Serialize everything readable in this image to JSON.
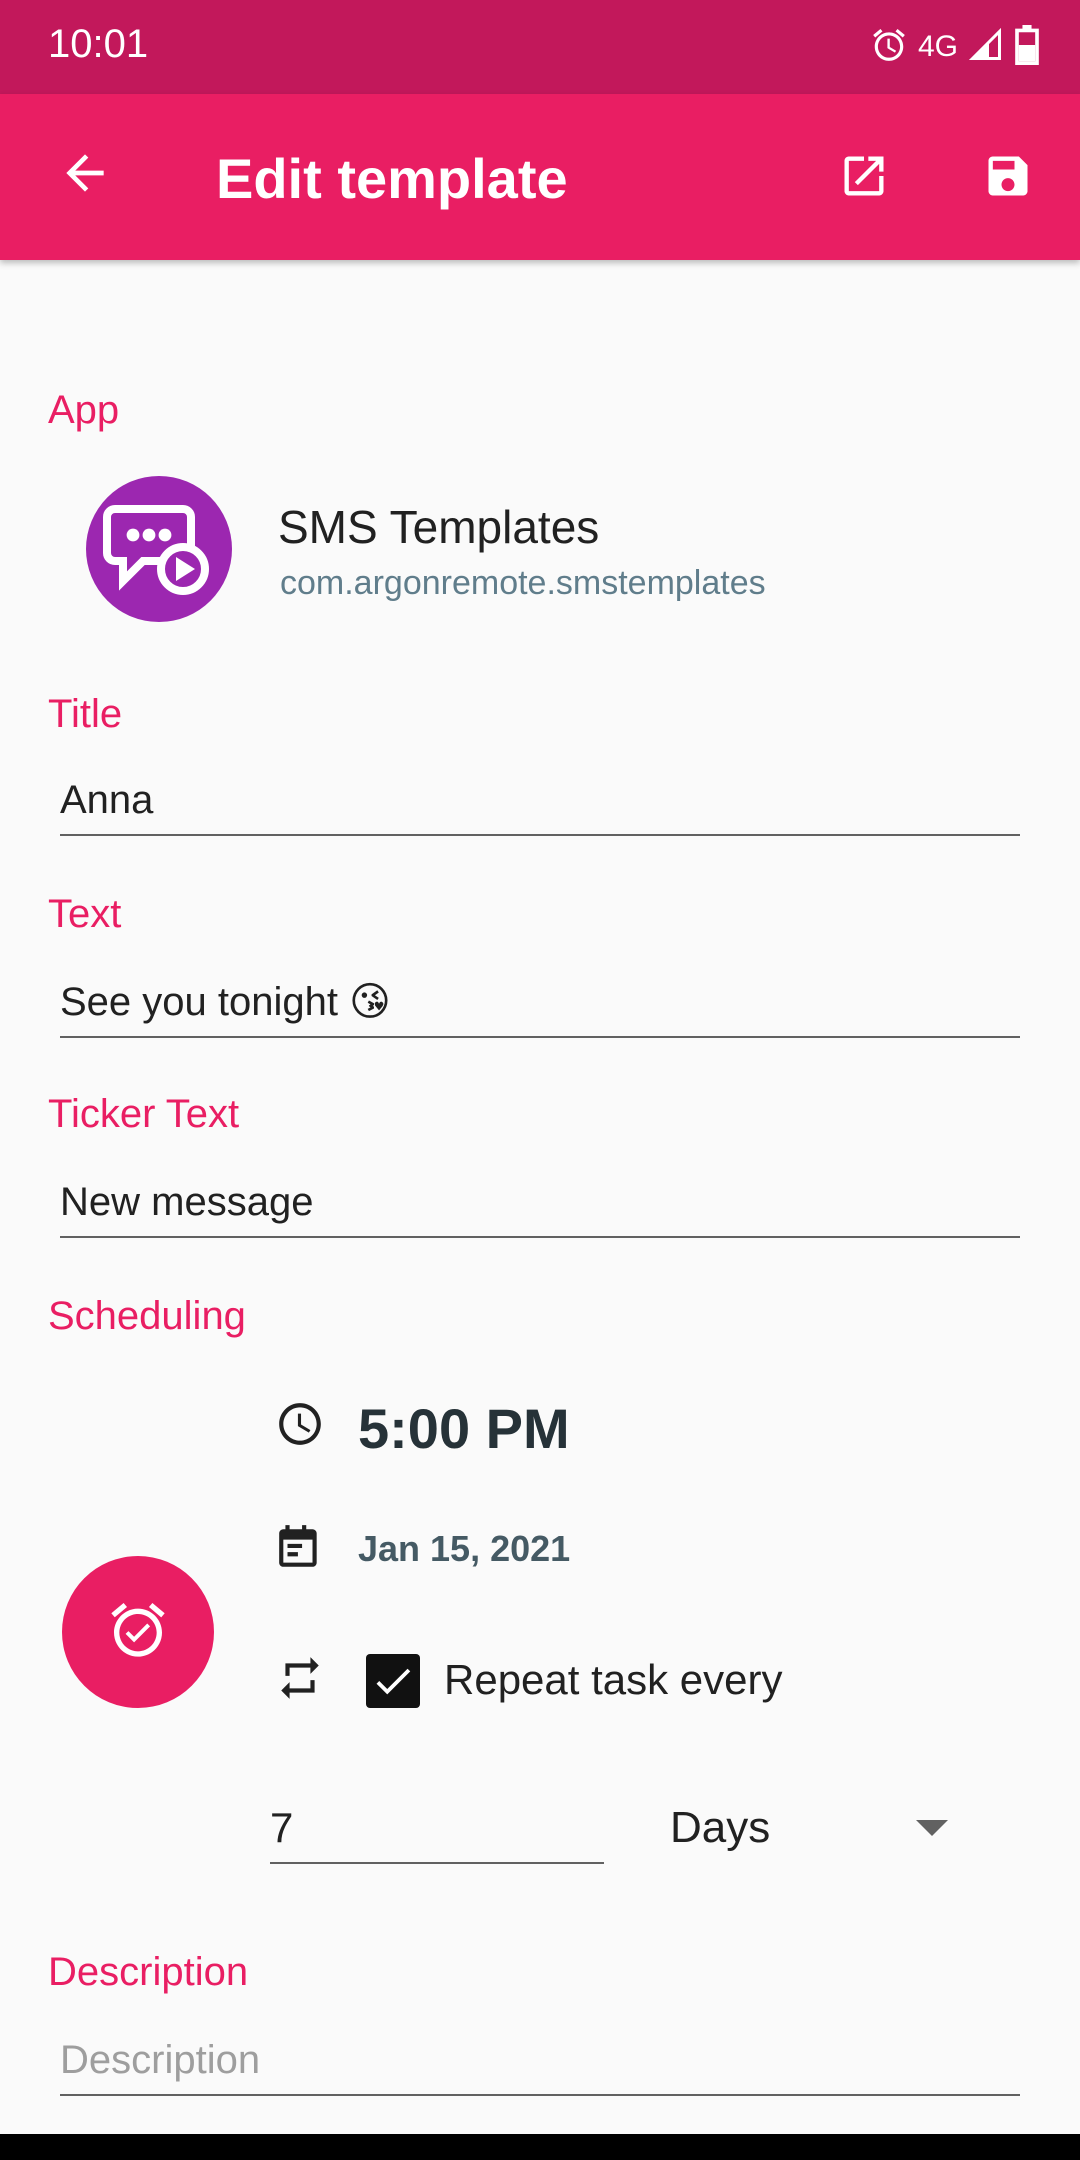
{
  "status_bar": {
    "time": "10:01",
    "network": "4G",
    "icons": [
      "alarm-icon",
      "signal-icon",
      "battery-icon"
    ]
  },
  "app_bar": {
    "title": "Edit template",
    "back_icon": "arrow-back-icon",
    "actions": [
      "open-external-icon",
      "save-icon"
    ]
  },
  "colors": {
    "primary": "#e91e63",
    "primary_dark": "#c2185b",
    "app_icon_bg": "#9c27b0"
  },
  "app_section": {
    "label": "App",
    "app_name": "SMS Templates",
    "package": "com.argonremote.smstemplates",
    "icon": "sms-templates-app-icon"
  },
  "title_section": {
    "label": "Title",
    "value": "Anna"
  },
  "text_section": {
    "label": "Text",
    "value": "See you tonight 😘"
  },
  "ticker_section": {
    "label": "Ticker Text",
    "value": "New message"
  },
  "scheduling": {
    "label": "Scheduling",
    "time": "5:00 PM",
    "date": "Jan 15, 2021",
    "repeat_label": "Repeat task every",
    "repeat_checked": true,
    "interval_value": "7",
    "interval_unit": "Days",
    "fab_icon": "alarm-check-icon"
  },
  "description_section": {
    "label": "Description",
    "placeholder": "Description",
    "value": ""
  }
}
